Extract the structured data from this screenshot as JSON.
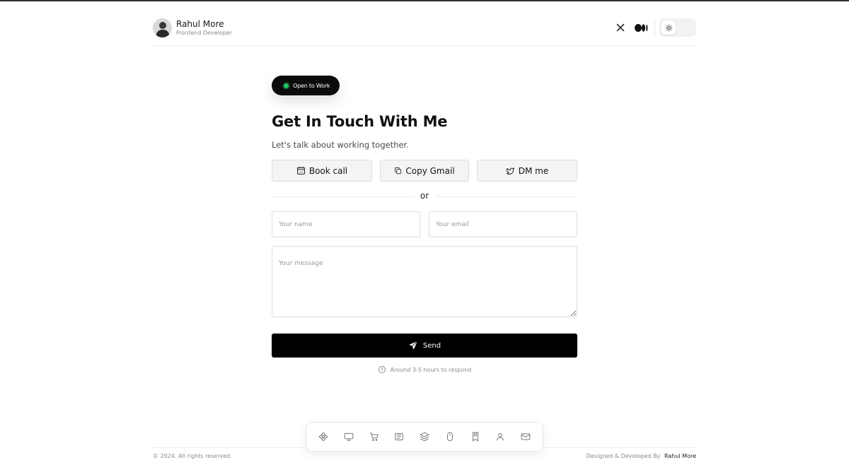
{
  "header": {
    "name": "Rahul More",
    "role": "Frontend Developer",
    "icons": [
      "x-twitter-icon",
      "medium-icon",
      "sun-icon"
    ]
  },
  "badge": {
    "label": "Open to Work"
  },
  "contact": {
    "title": "Get In Touch With Me",
    "subtitle": "Let's talk about working together.",
    "actions": [
      {
        "label": "Book call",
        "icon": "calendar-icon"
      },
      {
        "label": "Copy Gmail",
        "icon": "copy-icon"
      },
      {
        "label": "DM me",
        "icon": "twitter-bird-icon"
      }
    ],
    "or_label": "or",
    "form": {
      "name_placeholder": "Your name",
      "email_placeholder": "Your email",
      "message_placeholder": "Your message",
      "send_label": "Send"
    },
    "respond_note": "Around 3-5 hours to respond"
  },
  "dock": {
    "items": [
      "component-icon",
      "monitor-icon",
      "cart-icon",
      "newspaper-icon",
      "layers-icon",
      "mouse-icon",
      "bookmark-icon",
      "user-icon",
      "mail-icon"
    ]
  },
  "footer": {
    "copyright": "© 2024. All rights reserved.",
    "credit_prefix": "Designed & Developed By",
    "credit_name": "Rahul More"
  },
  "colors": {
    "accent": "#000000",
    "status_dot": "#22c55e",
    "border": "#dcdcdc"
  }
}
